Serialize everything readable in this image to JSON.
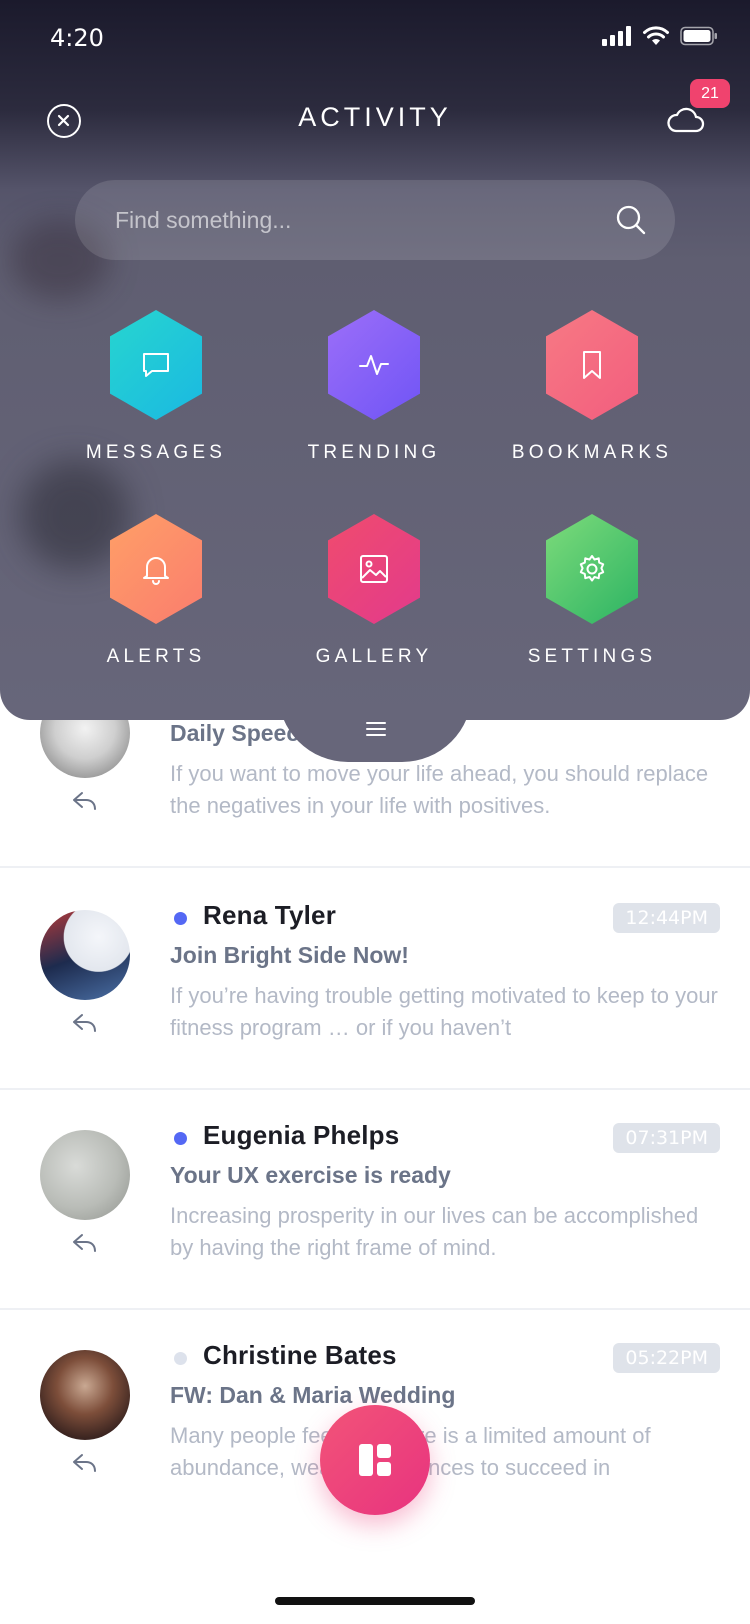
{
  "status_bar": {
    "time": "4:20"
  },
  "header": {
    "title": "ACTIVITY",
    "badge_count": "21"
  },
  "search": {
    "placeholder": "Find something..."
  },
  "menu": [
    {
      "label": "MESSAGES",
      "icon": "message-icon",
      "colors": [
        "#27d6cf",
        "#1ab8e2"
      ]
    },
    {
      "label": "TRENDING",
      "icon": "activity-icon",
      "colors": [
        "#9d6ff8",
        "#6f54f6"
      ]
    },
    {
      "label": "BOOKMARKS",
      "icon": "bookmark-icon",
      "colors": [
        "#f77a84",
        "#f25d7e"
      ]
    },
    {
      "label": "ALERTS",
      "icon": "bell-icon",
      "colors": [
        "#ffa067",
        "#fa7c6e"
      ]
    },
    {
      "label": "GALLERY",
      "icon": "image-icon",
      "colors": [
        "#f04c6d",
        "#e23a8c"
      ]
    },
    {
      "label": "SETTINGS",
      "icon": "gear-icon",
      "colors": [
        "#7fdc7b",
        "#2bb363"
      ]
    }
  ],
  "messages": [
    {
      "sender": "",
      "subject": "Daily Speech To Veronica",
      "preview": "If you want to move your life ahead, you should replace the negatives in your life with positives.",
      "time": "",
      "unread": false
    },
    {
      "sender": "Rena Tyler",
      "subject": "Join Bright Side Now!",
      "preview": "If you’re having trouble getting motivated to keep to your fitness program … or if you haven’t",
      "time": "12:44PM",
      "unread": true
    },
    {
      "sender": "Eugenia Phelps",
      "subject": "Your UX exercise is ready",
      "preview": "Increasing prosperity in our lives can be accomplished by having the right frame of mind.",
      "time": "07:31PM",
      "unread": true
    },
    {
      "sender": "Christine Bates",
      "subject": "FW: Dan & Maria Wedding",
      "preview": "Many people feel that there is a limited amount of abundance, wealth, or chances to succeed in",
      "time": "05:22PM",
      "unread": false
    }
  ],
  "colors": {
    "unread_dot": "#5468f4",
    "read_dot": "#dde2ec",
    "accent": "#ec407a"
  }
}
